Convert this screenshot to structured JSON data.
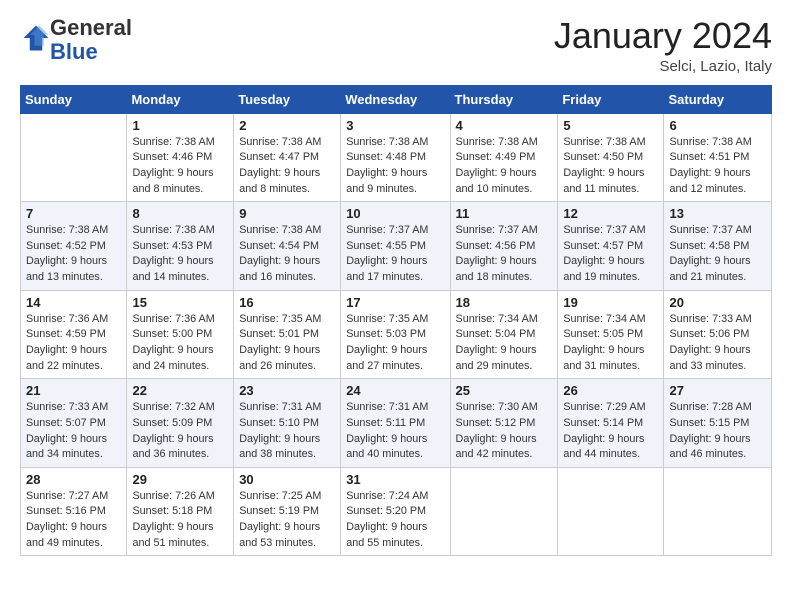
{
  "logo": {
    "general": "General",
    "blue": "Blue"
  },
  "header": {
    "month": "January 2024",
    "location": "Selci, Lazio, Italy"
  },
  "weekdays": [
    "Sunday",
    "Monday",
    "Tuesday",
    "Wednesday",
    "Thursday",
    "Friday",
    "Saturday"
  ],
  "weeks": [
    [
      {
        "day": "",
        "sunrise": "",
        "sunset": "",
        "daylight": ""
      },
      {
        "day": "1",
        "sunrise": "Sunrise: 7:38 AM",
        "sunset": "Sunset: 4:46 PM",
        "daylight": "Daylight: 9 hours and 8 minutes."
      },
      {
        "day": "2",
        "sunrise": "Sunrise: 7:38 AM",
        "sunset": "Sunset: 4:47 PM",
        "daylight": "Daylight: 9 hours and 8 minutes."
      },
      {
        "day": "3",
        "sunrise": "Sunrise: 7:38 AM",
        "sunset": "Sunset: 4:48 PM",
        "daylight": "Daylight: 9 hours and 9 minutes."
      },
      {
        "day": "4",
        "sunrise": "Sunrise: 7:38 AM",
        "sunset": "Sunset: 4:49 PM",
        "daylight": "Daylight: 9 hours and 10 minutes."
      },
      {
        "day": "5",
        "sunrise": "Sunrise: 7:38 AM",
        "sunset": "Sunset: 4:50 PM",
        "daylight": "Daylight: 9 hours and 11 minutes."
      },
      {
        "day": "6",
        "sunrise": "Sunrise: 7:38 AM",
        "sunset": "Sunset: 4:51 PM",
        "daylight": "Daylight: 9 hours and 12 minutes."
      }
    ],
    [
      {
        "day": "7",
        "sunrise": "Sunrise: 7:38 AM",
        "sunset": "Sunset: 4:52 PM",
        "daylight": "Daylight: 9 hours and 13 minutes."
      },
      {
        "day": "8",
        "sunrise": "Sunrise: 7:38 AM",
        "sunset": "Sunset: 4:53 PM",
        "daylight": "Daylight: 9 hours and 14 minutes."
      },
      {
        "day": "9",
        "sunrise": "Sunrise: 7:38 AM",
        "sunset": "Sunset: 4:54 PM",
        "daylight": "Daylight: 9 hours and 16 minutes."
      },
      {
        "day": "10",
        "sunrise": "Sunrise: 7:37 AM",
        "sunset": "Sunset: 4:55 PM",
        "daylight": "Daylight: 9 hours and 17 minutes."
      },
      {
        "day": "11",
        "sunrise": "Sunrise: 7:37 AM",
        "sunset": "Sunset: 4:56 PM",
        "daylight": "Daylight: 9 hours and 18 minutes."
      },
      {
        "day": "12",
        "sunrise": "Sunrise: 7:37 AM",
        "sunset": "Sunset: 4:57 PM",
        "daylight": "Daylight: 9 hours and 19 minutes."
      },
      {
        "day": "13",
        "sunrise": "Sunrise: 7:37 AM",
        "sunset": "Sunset: 4:58 PM",
        "daylight": "Daylight: 9 hours and 21 minutes."
      }
    ],
    [
      {
        "day": "14",
        "sunrise": "Sunrise: 7:36 AM",
        "sunset": "Sunset: 4:59 PM",
        "daylight": "Daylight: 9 hours and 22 minutes."
      },
      {
        "day": "15",
        "sunrise": "Sunrise: 7:36 AM",
        "sunset": "Sunset: 5:00 PM",
        "daylight": "Daylight: 9 hours and 24 minutes."
      },
      {
        "day": "16",
        "sunrise": "Sunrise: 7:35 AM",
        "sunset": "Sunset: 5:01 PM",
        "daylight": "Daylight: 9 hours and 26 minutes."
      },
      {
        "day": "17",
        "sunrise": "Sunrise: 7:35 AM",
        "sunset": "Sunset: 5:03 PM",
        "daylight": "Daylight: 9 hours and 27 minutes."
      },
      {
        "day": "18",
        "sunrise": "Sunrise: 7:34 AM",
        "sunset": "Sunset: 5:04 PM",
        "daylight": "Daylight: 9 hours and 29 minutes."
      },
      {
        "day": "19",
        "sunrise": "Sunrise: 7:34 AM",
        "sunset": "Sunset: 5:05 PM",
        "daylight": "Daylight: 9 hours and 31 minutes."
      },
      {
        "day": "20",
        "sunrise": "Sunrise: 7:33 AM",
        "sunset": "Sunset: 5:06 PM",
        "daylight": "Daylight: 9 hours and 33 minutes."
      }
    ],
    [
      {
        "day": "21",
        "sunrise": "Sunrise: 7:33 AM",
        "sunset": "Sunset: 5:07 PM",
        "daylight": "Daylight: 9 hours and 34 minutes."
      },
      {
        "day": "22",
        "sunrise": "Sunrise: 7:32 AM",
        "sunset": "Sunset: 5:09 PM",
        "daylight": "Daylight: 9 hours and 36 minutes."
      },
      {
        "day": "23",
        "sunrise": "Sunrise: 7:31 AM",
        "sunset": "Sunset: 5:10 PM",
        "daylight": "Daylight: 9 hours and 38 minutes."
      },
      {
        "day": "24",
        "sunrise": "Sunrise: 7:31 AM",
        "sunset": "Sunset: 5:11 PM",
        "daylight": "Daylight: 9 hours and 40 minutes."
      },
      {
        "day": "25",
        "sunrise": "Sunrise: 7:30 AM",
        "sunset": "Sunset: 5:12 PM",
        "daylight": "Daylight: 9 hours and 42 minutes."
      },
      {
        "day": "26",
        "sunrise": "Sunrise: 7:29 AM",
        "sunset": "Sunset: 5:14 PM",
        "daylight": "Daylight: 9 hours and 44 minutes."
      },
      {
        "day": "27",
        "sunrise": "Sunrise: 7:28 AM",
        "sunset": "Sunset: 5:15 PM",
        "daylight": "Daylight: 9 hours and 46 minutes."
      }
    ],
    [
      {
        "day": "28",
        "sunrise": "Sunrise: 7:27 AM",
        "sunset": "Sunset: 5:16 PM",
        "daylight": "Daylight: 9 hours and 49 minutes."
      },
      {
        "day": "29",
        "sunrise": "Sunrise: 7:26 AM",
        "sunset": "Sunset: 5:18 PM",
        "daylight": "Daylight: 9 hours and 51 minutes."
      },
      {
        "day": "30",
        "sunrise": "Sunrise: 7:25 AM",
        "sunset": "Sunset: 5:19 PM",
        "daylight": "Daylight: 9 hours and 53 minutes."
      },
      {
        "day": "31",
        "sunrise": "Sunrise: 7:24 AM",
        "sunset": "Sunset: 5:20 PM",
        "daylight": "Daylight: 9 hours and 55 minutes."
      },
      {
        "day": "",
        "sunrise": "",
        "sunset": "",
        "daylight": ""
      },
      {
        "day": "",
        "sunrise": "",
        "sunset": "",
        "daylight": ""
      },
      {
        "day": "",
        "sunrise": "",
        "sunset": "",
        "daylight": ""
      }
    ]
  ]
}
